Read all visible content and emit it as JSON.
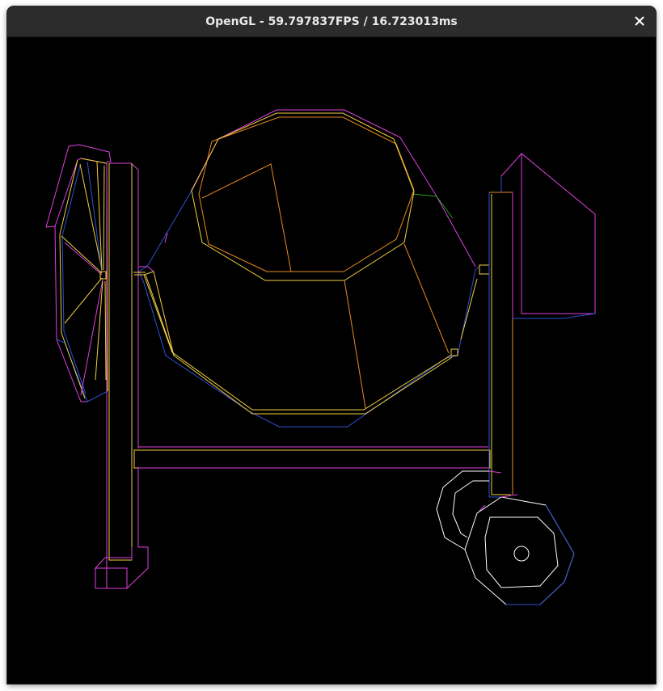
{
  "window": {
    "title": "OpenGL - 59.797837FPS / 16.723013ms",
    "close_icon": "close-icon"
  },
  "scene": {
    "description_icon": "wireframe-render",
    "background": "#000000",
    "colors": {
      "magenta": "#e040e0",
      "yellow": "#f0d040",
      "orange": "#e88a20",
      "blue": "#3050d0",
      "white": "#ffffff",
      "green": "#20a020",
      "gray": "#9a9ab0"
    }
  }
}
